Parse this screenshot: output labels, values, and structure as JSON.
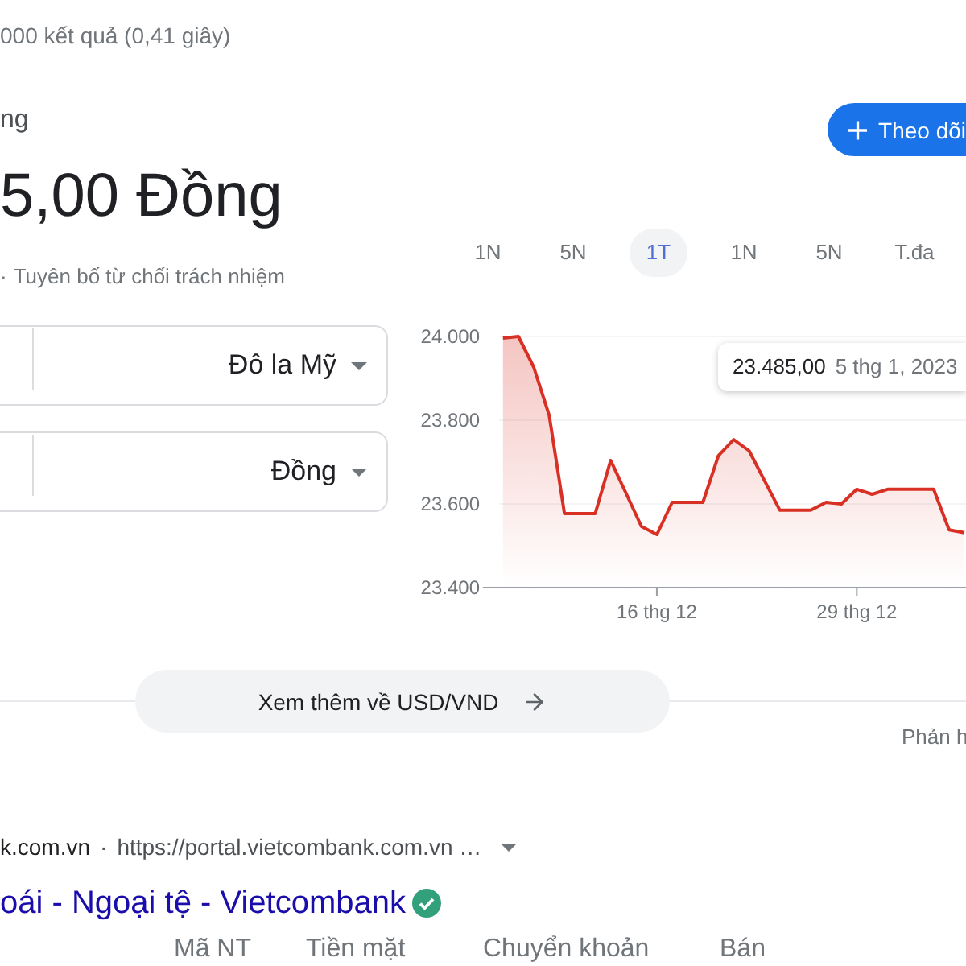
{
  "results_stats": "000 kết quả (0,41 giây)",
  "converter": {
    "heading": "ng",
    "value": "5,00 Đồng",
    "disclaimer_separator": "·",
    "disclaimer": "Tuyên bố từ chối trách nhiệm",
    "fields": [
      {
        "currency": "Đô la Mỹ"
      },
      {
        "currency": "Đồng"
      }
    ]
  },
  "follow_button": {
    "label": "Theo dõi"
  },
  "range_tabs": [
    {
      "label": "1N",
      "selected": false
    },
    {
      "label": "5N",
      "selected": false
    },
    {
      "label": "1T",
      "selected": true
    },
    {
      "label": "1N",
      "selected": false
    },
    {
      "label": "5N",
      "selected": false
    },
    {
      "label": "T.đa",
      "selected": false
    }
  ],
  "chart": {
    "tooltip": {
      "value": "23.485,00",
      "date": "5 thg 1, 2023"
    },
    "chart_data": {
      "type": "area",
      "categories": [
        null,
        null,
        null,
        null,
        null,
        null,
        null,
        null,
        null,
        null,
        "16 thg 12",
        null,
        null,
        null,
        null,
        null,
        null,
        null,
        null,
        null,
        null,
        null,
        null,
        "29 thg 12",
        null,
        null,
        null,
        null,
        null,
        null,
        null
      ],
      "series": [
        {
          "color": "#d93025",
          "values": [
            23996,
            24000,
            23927,
            23812,
            23577,
            23577,
            23577,
            23704,
            23625,
            23546,
            23527,
            23604,
            23604,
            23604,
            23715,
            23754,
            23727,
            23656,
            23585,
            23585,
            23585,
            23604,
            23600,
            23635,
            23623,
            23635,
            23635,
            23635,
            23635,
            23538,
            23531
          ]
        }
      ],
      "ylim": [
        23400,
        24000
      ],
      "yticks": [
        {
          "value": 24000,
          "label": "24.000"
        },
        {
          "value": 23800,
          "label": "23.800"
        },
        {
          "value": 23600,
          "label": "23.600"
        },
        {
          "value": 23400,
          "label": "23.400"
        }
      ]
    }
  },
  "more_button": {
    "label": "Xem thêm về USD/VND"
  },
  "feedback_link": "Phản h",
  "result": {
    "site": "k.com.vn",
    "separator": "·",
    "url": "https://portal.vietcombank.com.vn …",
    "title": "oái - Ngoại tệ - Vietcombank",
    "verified": true,
    "table_columns": [
      "Mã NT",
      "Tiền mặt",
      "Chuyển khoản",
      "Bán"
    ]
  }
}
